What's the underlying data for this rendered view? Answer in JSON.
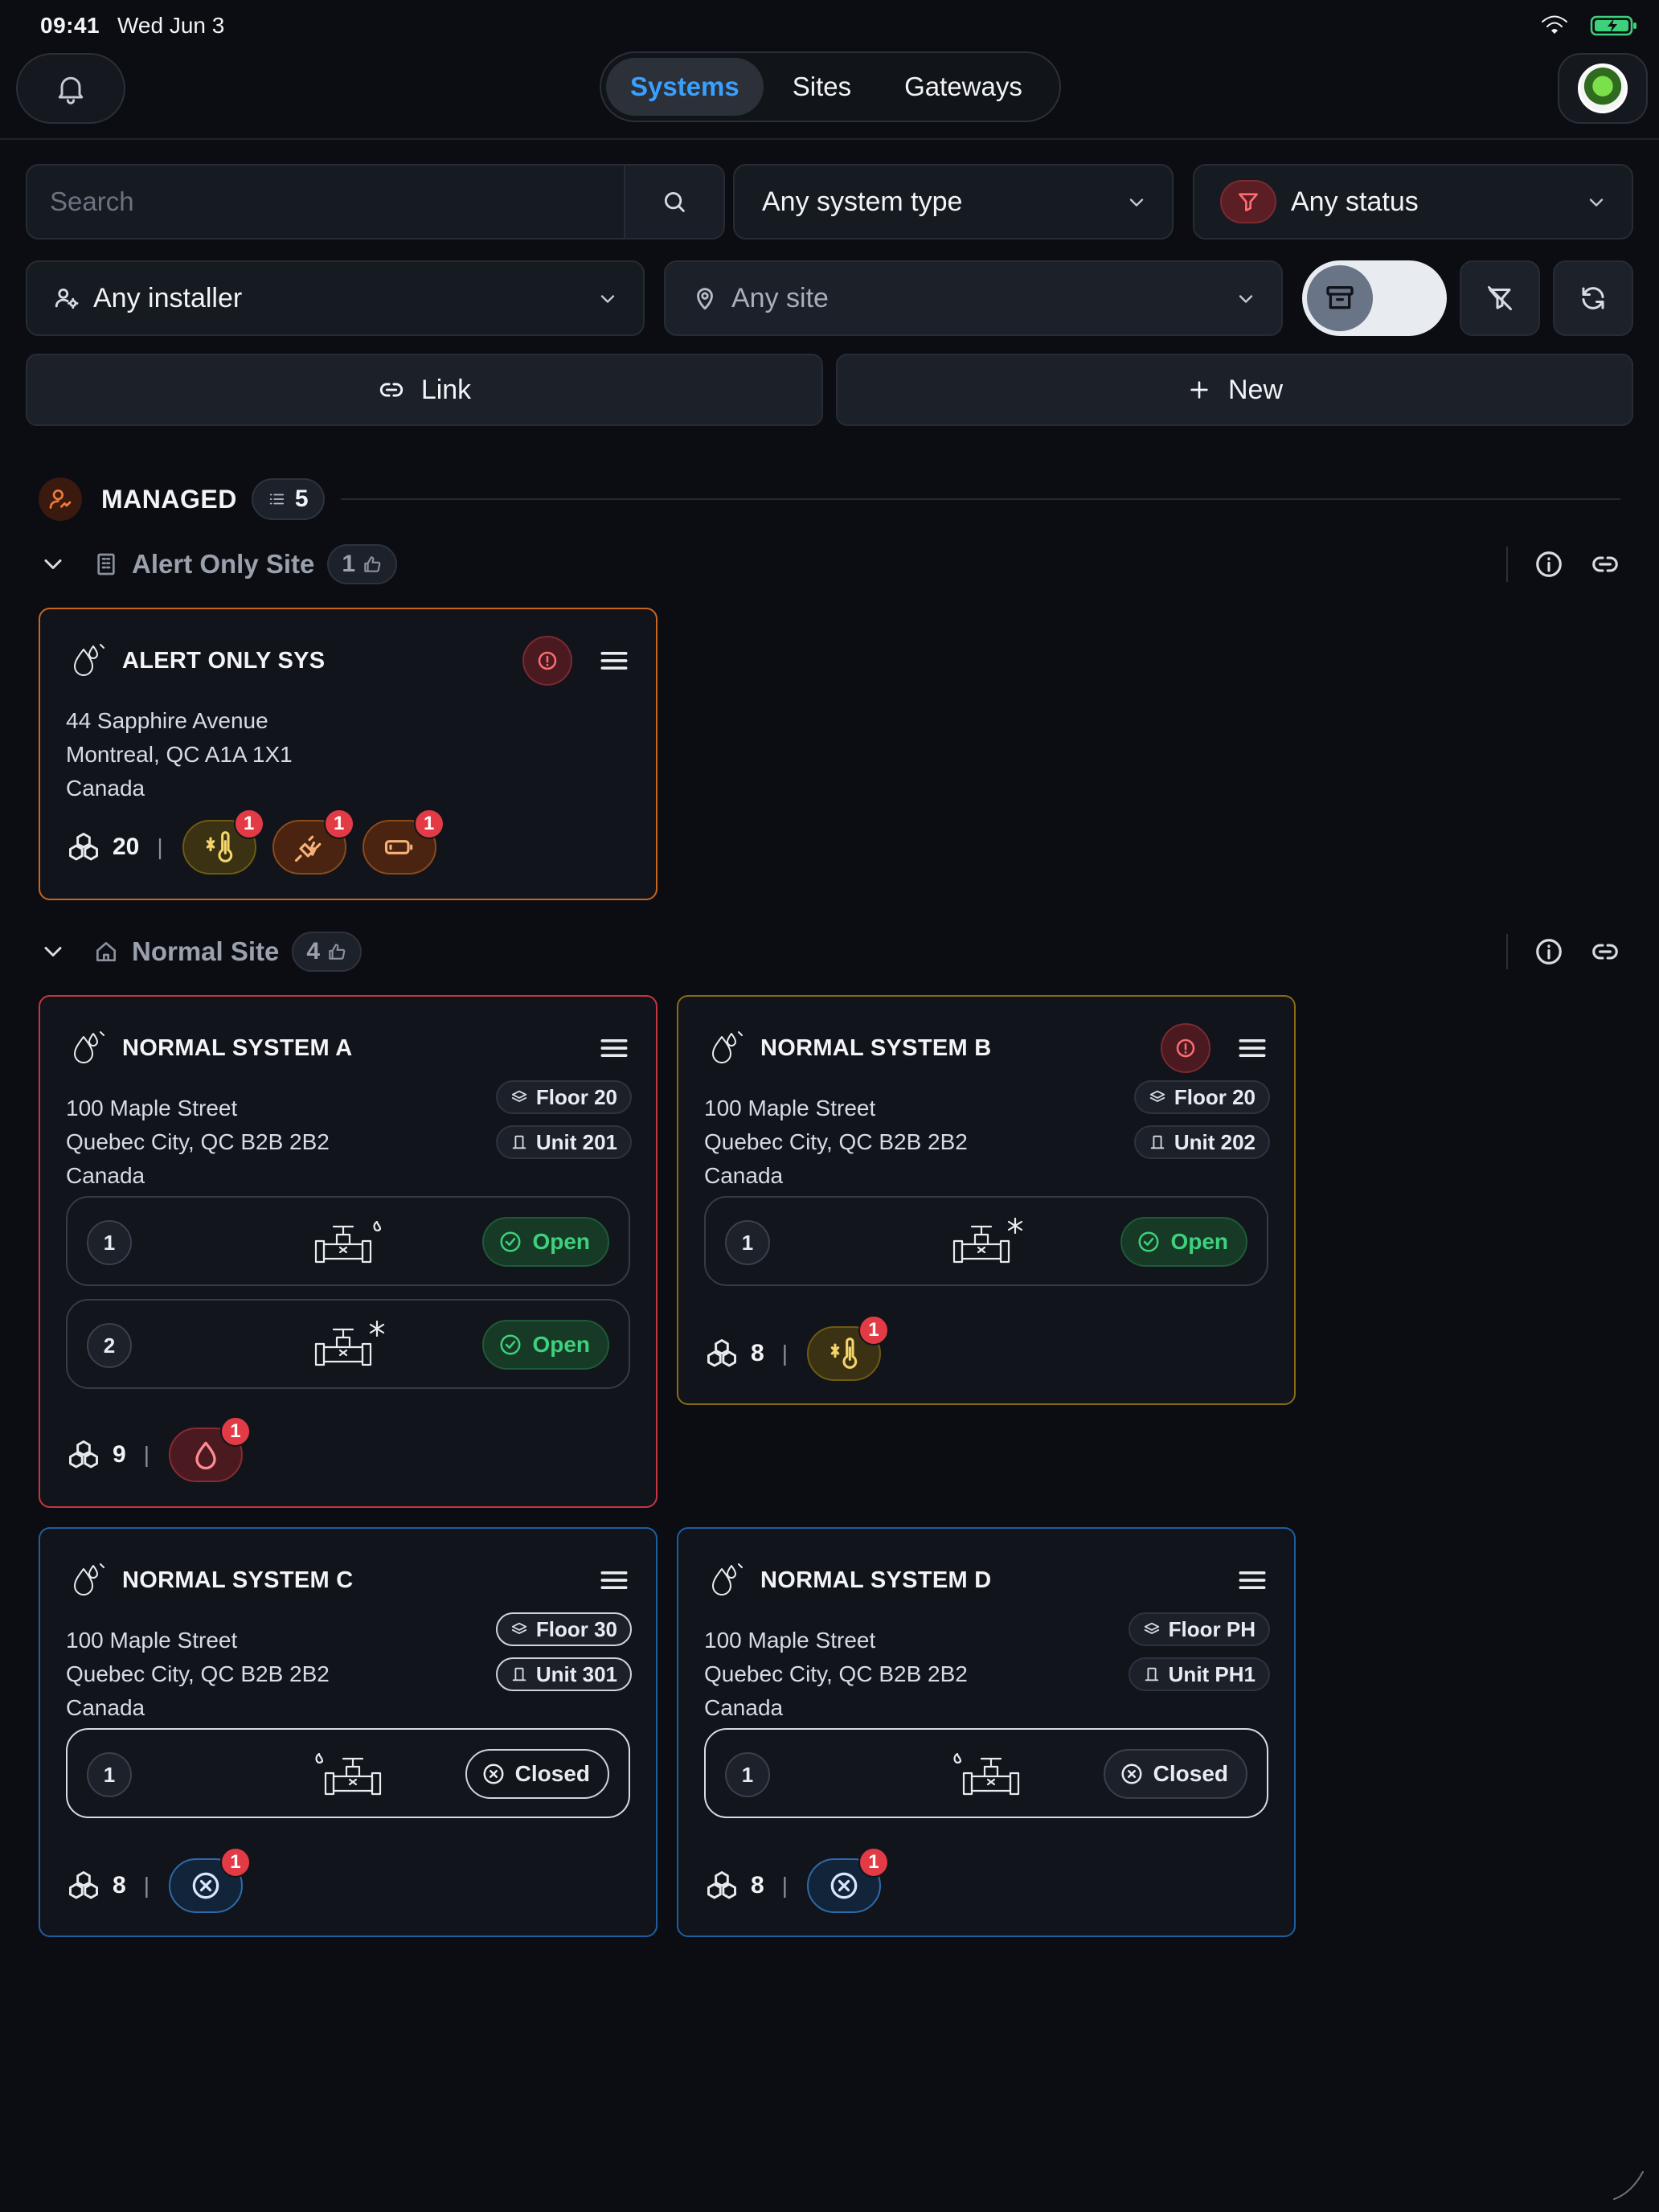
{
  "status_bar": {
    "time": "09:41",
    "date": "Wed Jun 3"
  },
  "header": {
    "tabs": [
      {
        "label": "Systems",
        "active": true
      },
      {
        "label": "Sites",
        "active": false
      },
      {
        "label": "Gateways",
        "active": false
      }
    ]
  },
  "filters": {
    "search_placeholder": "Search",
    "system_type": "Any system type",
    "status": "Any status",
    "installer": "Any installer",
    "site": "Any site"
  },
  "actions": {
    "link_label": "Link",
    "new_label": "New"
  },
  "managed": {
    "label": "MANAGED",
    "count": "5"
  },
  "sites": [
    {
      "name": "Alert Only Site",
      "count": "1"
    },
    {
      "name": "Normal Site",
      "count": "4"
    }
  ],
  "systems": [
    {
      "title": "ALERT ONLY SYS",
      "address": [
        "44 Sapphire Avenue",
        "Montreal, QC A1A 1X1",
        "Canada"
      ],
      "devices": "20",
      "alerts": [
        {
          "type": "temperature-icon",
          "count": "1"
        },
        {
          "type": "plug-icon",
          "count": "1"
        },
        {
          "type": "battery-icon",
          "count": "1"
        }
      ]
    },
    {
      "title": "NORMAL SYSTEM A",
      "address": [
        "100 Maple Street",
        "Quebec City, QC B2B 2B2",
        "Canada"
      ],
      "floor": "Floor 20",
      "unit": "Unit 201",
      "valves": [
        {
          "num": "1",
          "state": "Open"
        },
        {
          "num": "2",
          "state": "Open"
        }
      ],
      "devices": "9",
      "alerts": [
        {
          "type": "water-drop-icon",
          "count": "1"
        }
      ]
    },
    {
      "title": "NORMAL SYSTEM B",
      "address": [
        "100 Maple Street",
        "Quebec City, QC B2B 2B2",
        "Canada"
      ],
      "floor": "Floor 20",
      "unit": "Unit 202",
      "valves": [
        {
          "num": "1",
          "state": "Open"
        }
      ],
      "devices": "8",
      "alerts": [
        {
          "type": "temperature-icon",
          "count": "1"
        }
      ]
    },
    {
      "title": "NORMAL SYSTEM C",
      "address": [
        "100 Maple Street",
        "Quebec City, QC B2B 2B2",
        "Canada"
      ],
      "floor": "Floor 30",
      "unit": "Unit 301",
      "valves": [
        {
          "num": "1",
          "state": "Closed"
        }
      ],
      "devices": "8",
      "alerts": [
        {
          "type": "valve-closed-icon",
          "count": "1"
        }
      ]
    },
    {
      "title": "NORMAL SYSTEM D",
      "address": [
        "100 Maple Street",
        "Quebec City, QC B2B 2B2",
        "Canada"
      ],
      "floor": "Floor PH",
      "unit": "Unit PH1",
      "valves": [
        {
          "num": "1",
          "state": "Closed"
        }
      ],
      "devices": "8",
      "alerts": [
        {
          "type": "valve-closed-icon",
          "count": "1"
        }
      ]
    }
  ],
  "colors": {
    "accent": "#3aa0ff",
    "card_alert_only": "#c7651d",
    "card_a": "#c8353e",
    "card_b": "#8a6b15",
    "card_cd": "#1e5ea0",
    "open_green": "#3ed17d",
    "badge_red": "#e23b45"
  }
}
